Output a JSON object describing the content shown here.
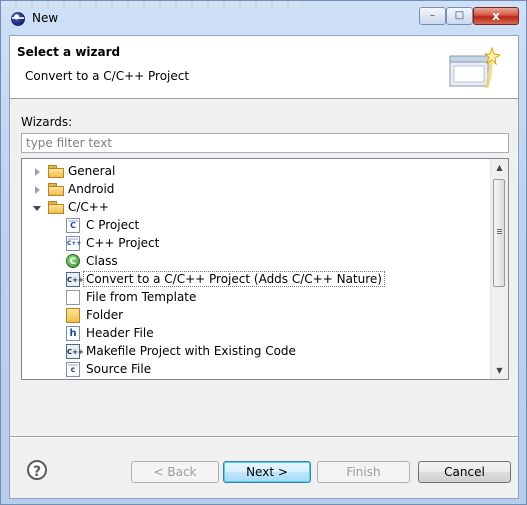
{
  "window": {
    "title": "New",
    "controls": {
      "minimize": "–",
      "maximize": "□",
      "close": "x"
    }
  },
  "header": {
    "title": "Select a wizard",
    "subtitle": "Convert to a C/C++ Project"
  },
  "filter": {
    "label": "Wizards:",
    "placeholder": "type filter text",
    "value": ""
  },
  "tree": {
    "items": [
      {
        "label": "General",
        "level": 0,
        "type": "folder",
        "expanded": false
      },
      {
        "label": "Android",
        "level": 0,
        "type": "folder",
        "expanded": false
      },
      {
        "label": "C/C++",
        "level": 0,
        "type": "folder",
        "expanded": true
      },
      {
        "label": "C Project",
        "level": 1,
        "icon": "c-project-icon"
      },
      {
        "label": "C++ Project",
        "level": 1,
        "icon": "cpp-project-icon"
      },
      {
        "label": "Class",
        "level": 1,
        "icon": "class-icon"
      },
      {
        "label": "Convert to a C/C++ Project (Adds C/C++ Nature)",
        "level": 1,
        "icon": "convert-project-icon",
        "selected": true
      },
      {
        "label": "File from Template",
        "level": 1,
        "icon": "file-template-icon"
      },
      {
        "label": "Folder",
        "level": 1,
        "icon": "source-folder-icon"
      },
      {
        "label": "Header File",
        "level": 1,
        "icon": "header-file-icon"
      },
      {
        "label": "Makefile Project with Existing Code",
        "level": 1,
        "icon": "makefile-project-icon"
      },
      {
        "label": "Source File",
        "level": 1,
        "icon": "source-file-icon"
      }
    ]
  },
  "buttons": {
    "help": "?",
    "back": "< Back",
    "next": "Next >",
    "finish": "Finish",
    "cancel": "Cancel"
  },
  "colors": {
    "window_frame": "#c9daf0",
    "dialog_bg": "#f0f0f0",
    "default_button": "#bee6fd",
    "close_button": "#d4563f"
  }
}
